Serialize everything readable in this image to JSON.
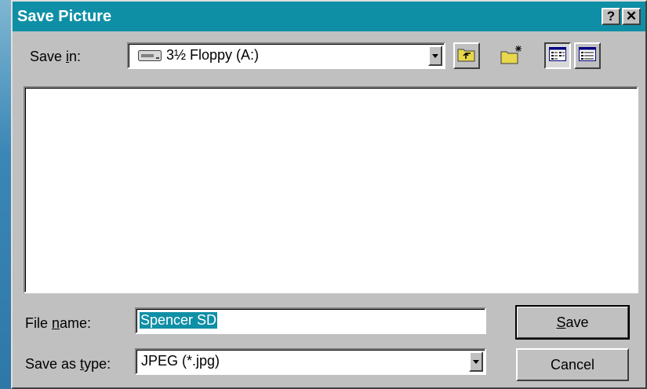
{
  "dialog": {
    "title": "Save Picture",
    "help_button": "?",
    "close_button": "✕"
  },
  "save_in": {
    "label_pre": "Save ",
    "label_ul": "i",
    "label_post": "n:",
    "value": "3½ Floppy (A:)",
    "icon": "floppy-drive-icon"
  },
  "toolbar": {
    "up_folder_icon": "up-one-level-icon",
    "new_folder_icon": "create-new-folder-icon",
    "list_view_icon": "list-view-icon",
    "details_view_icon": "details-view-icon"
  },
  "file_name": {
    "label_pre": "File ",
    "label_ul": "n",
    "label_post": "ame:",
    "value": "Spencer SD"
  },
  "save_as_type": {
    "label_pre": "Save as ",
    "label_ul": "t",
    "label_post": "ype:",
    "value": "JPEG (*.jpg)"
  },
  "buttons": {
    "save_ul": "S",
    "save_rest": "ave",
    "cancel": "Cancel"
  },
  "colors": {
    "title_bar": "#0f8fa6",
    "face": "#c0c0c0",
    "selection": "#0f8fa6"
  }
}
